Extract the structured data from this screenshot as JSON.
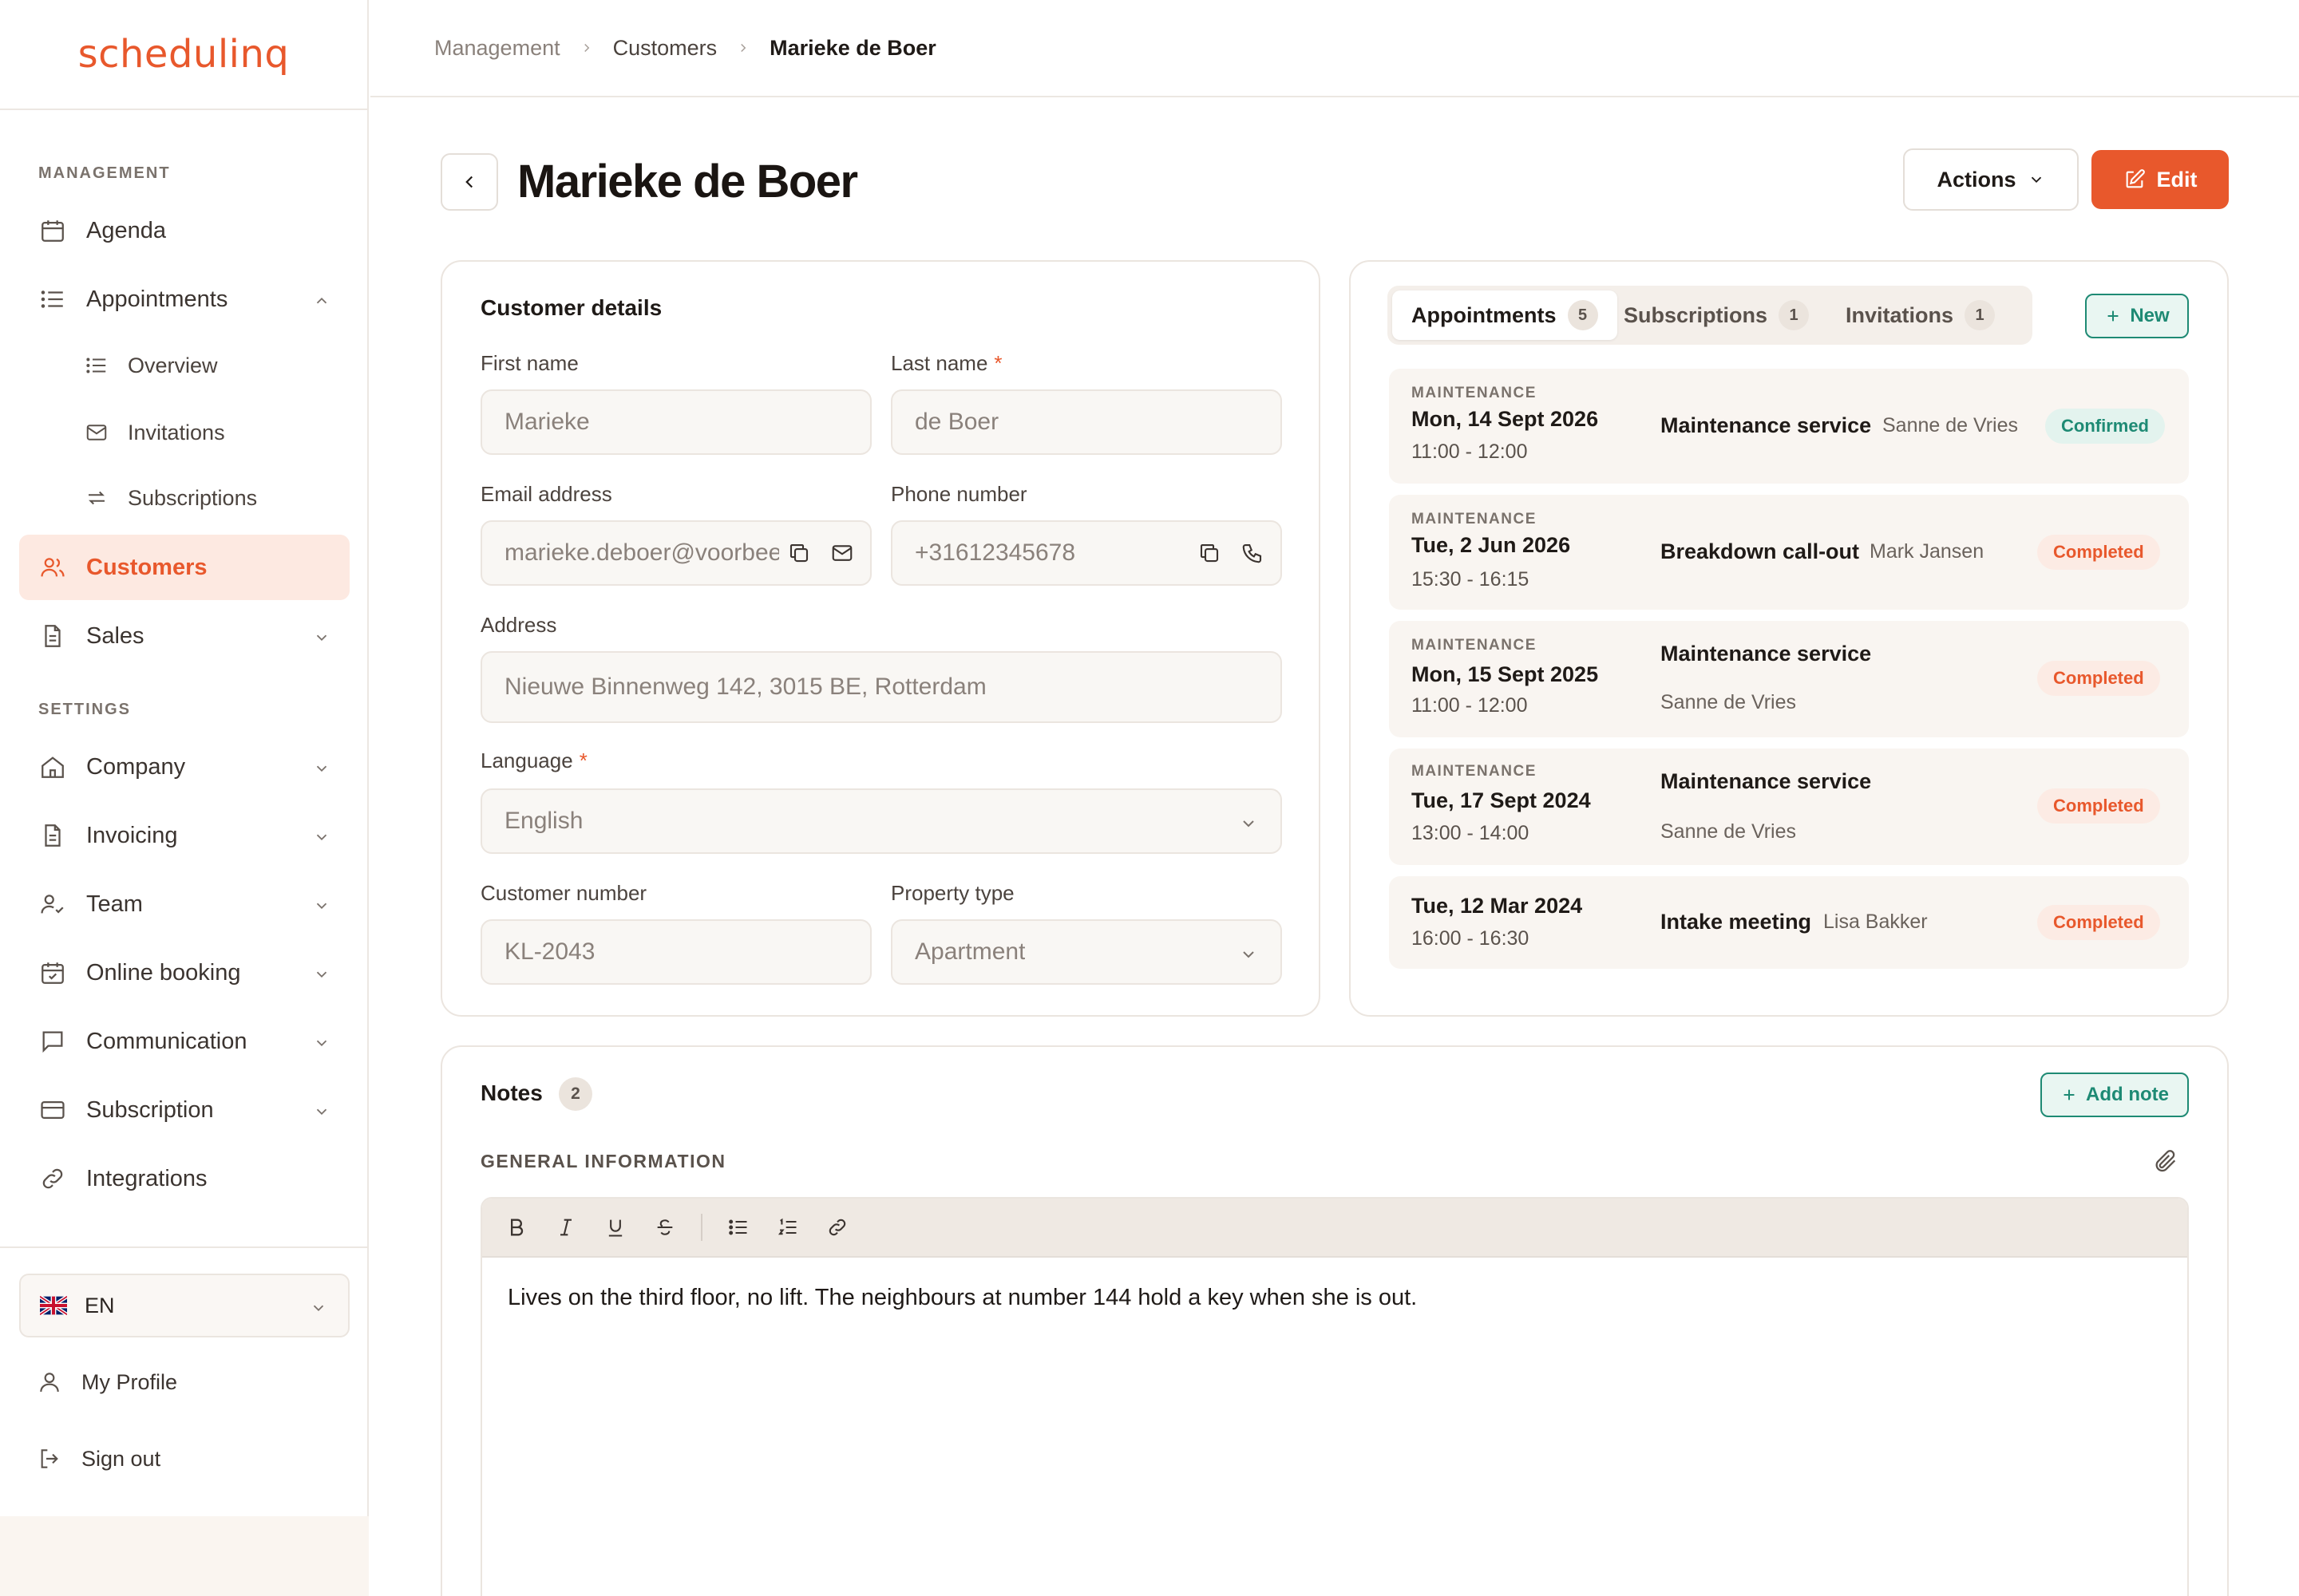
{
  "app": {
    "logo": "schedulinq"
  },
  "sidebar": {
    "management_label": "MANAGEMENT",
    "settings_label": "SETTINGS",
    "items": {
      "agenda": "Agenda",
      "appointments": "Appointments",
      "overview": "Overview",
      "invitations": "Invitations",
      "subscriptions": "Subscriptions",
      "customers": "Customers",
      "sales": "Sales",
      "company": "Company",
      "invoicing": "Invoicing",
      "team": "Team",
      "online_booking": "Online booking",
      "communication": "Communication",
      "subscription": "Subscription",
      "integrations": "Integrations"
    },
    "language": "EN",
    "my_profile": "My Profile",
    "sign_out": "Sign out"
  },
  "breadcrumb": [
    "Management",
    "Customers",
    "Marieke de Boer"
  ],
  "page": {
    "title": "Marieke de Boer",
    "actions_label": "Actions",
    "edit_label": "Edit"
  },
  "customer": {
    "card_title": "Customer details",
    "first_name": {
      "label": "First name",
      "value": "Marieke"
    },
    "last_name": {
      "label": "Last name",
      "value": "de Boer",
      "required": "*"
    },
    "email": {
      "label": "Email address",
      "value": "marieke.deboer@voorbeeld.nl"
    },
    "phone": {
      "label": "Phone number",
      "value": "+31612345678"
    },
    "address": {
      "label": "Address",
      "value": "Nieuwe Binnenweg 142, 3015 BE, Rotterdam"
    },
    "language": {
      "label": "Language",
      "value": "English",
      "required": "*"
    },
    "customer_number": {
      "label": "Customer number",
      "value": "KL-2043"
    },
    "property_type": {
      "label": "Property type",
      "value": "Apartment"
    }
  },
  "tabs": [
    {
      "label": "Appointments",
      "count": "5",
      "active": true
    },
    {
      "label": "Subscriptions",
      "count": "1"
    },
    {
      "label": "Invitations",
      "count": "1"
    }
  ],
  "new_label": "New",
  "appointments": [
    {
      "category": "MAINTENANCE",
      "date": "Mon, 14 Sept 2026",
      "time": "11:00 - 12:00",
      "service": "Maintenance service",
      "person": "Sanne de Vries",
      "status": "Confirmed"
    },
    {
      "category": "MAINTENANCE",
      "date": "Tue, 2 Jun 2026",
      "time": "15:30 - 16:15",
      "service": "Breakdown call-out",
      "person": "Mark Jansen",
      "status": "Completed"
    },
    {
      "category": "MAINTENANCE",
      "date": "Mon, 15 Sept 2025",
      "time": "11:00 - 12:00",
      "service": "Maintenance service",
      "person": "Sanne de Vries",
      "status": "Completed"
    },
    {
      "category": "MAINTENANCE",
      "date": "Tue, 17 Sept 2024",
      "time": "13:00 - 14:00",
      "service": "Maintenance service",
      "person": "Sanne de Vries",
      "status": "Completed"
    },
    {
      "category": "",
      "date": "Tue, 12 Mar 2024",
      "time": "16:00 - 16:30",
      "service": "Intake meeting",
      "person": "Lisa Bakker",
      "status": "Completed"
    }
  ],
  "notes": {
    "title": "Notes",
    "count": "2",
    "add_label": "Add note",
    "section_label": "GENERAL INFORMATION",
    "text": "Lives on the third floor, no lift. The neighbours at number 144 hold a key when she is out."
  },
  "colors": {
    "accent": "#e8582c",
    "teal": "#1e8a74",
    "bg_soft": "#f9f7f4"
  }
}
